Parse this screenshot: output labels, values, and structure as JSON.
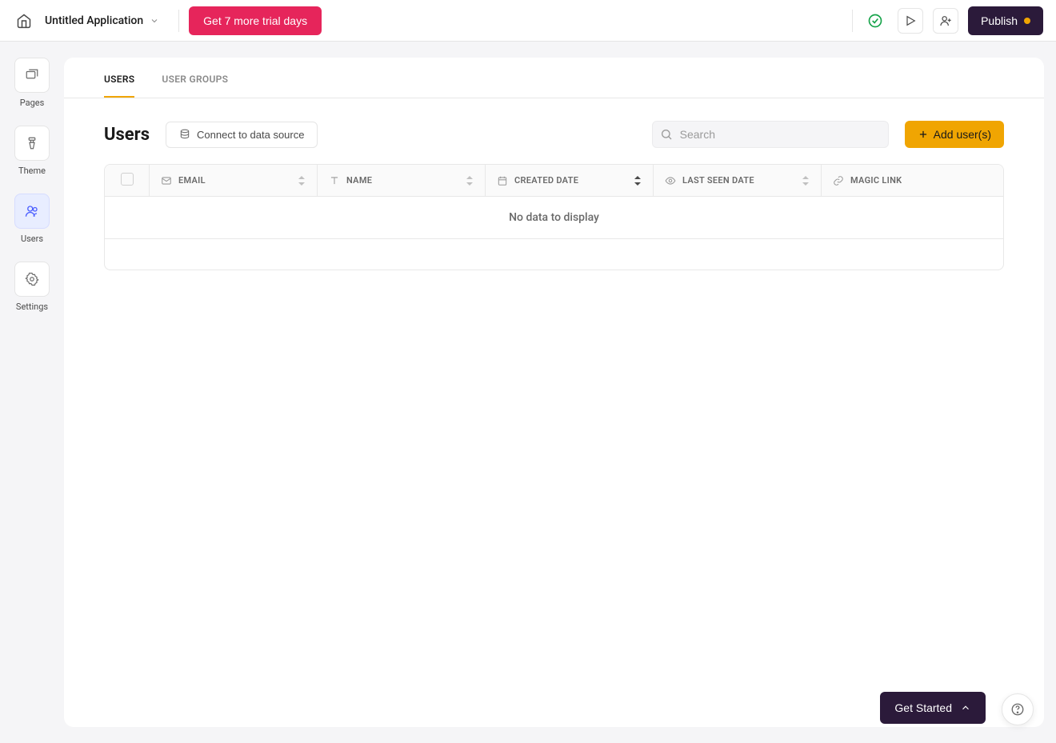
{
  "header": {
    "app_title": "Untitled Application",
    "trial_button": "Get 7 more trial days",
    "publish_button": "Publish"
  },
  "sidebar": {
    "items": [
      {
        "label": "Pages",
        "active": false
      },
      {
        "label": "Theme",
        "active": false
      },
      {
        "label": "Users",
        "active": true
      },
      {
        "label": "Settings",
        "active": false
      }
    ]
  },
  "tabs": {
    "users": "USERS",
    "user_groups": "USER GROUPS"
  },
  "toolbar": {
    "heading": "Users",
    "connect_label": "Connect to data source",
    "search_placeholder": "Search",
    "add_user_label": "Add user(s)"
  },
  "table": {
    "columns": {
      "email": "EMAIL",
      "name": "NAME",
      "created_date": "CREATED DATE",
      "last_seen_date": "LAST SEEN DATE",
      "magic_link": "MAGIC LINK"
    },
    "empty_message": "No data to display"
  },
  "footer": {
    "get_started": "Get Started"
  },
  "colors": {
    "accent_pink": "#e6255b",
    "accent_orange": "#f0a502",
    "accent_green": "#16a34a",
    "dark_purple": "#2b1a3a",
    "active_blue": "#4d60ff"
  }
}
